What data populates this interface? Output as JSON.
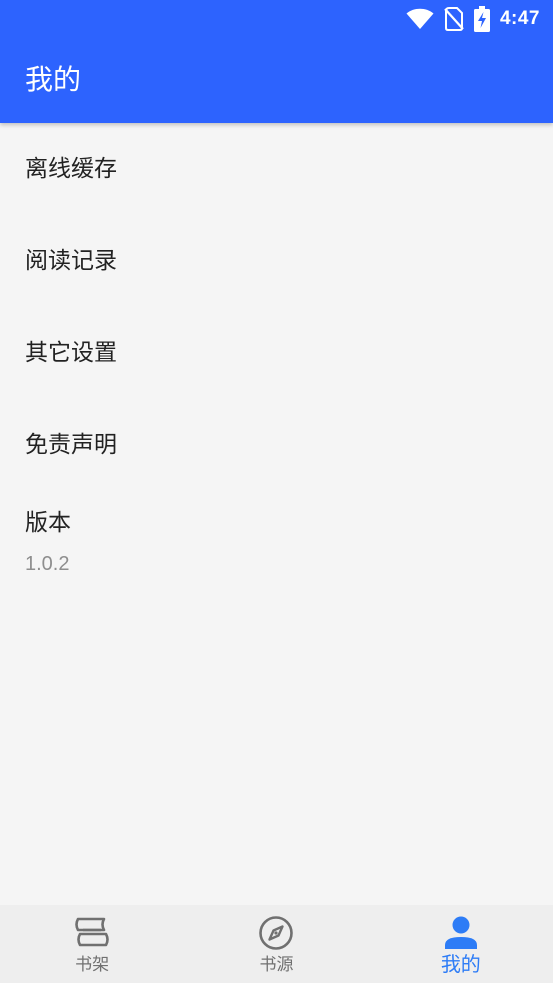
{
  "status_bar": {
    "time": "4:47",
    "icons": [
      "wifi-icon",
      "no-sim-icon",
      "battery-charging-icon"
    ]
  },
  "app_bar": {
    "title": "我的"
  },
  "menu": {
    "items": [
      {
        "label": "离线缓存"
      },
      {
        "label": "阅读记录"
      },
      {
        "label": "其它设置"
      },
      {
        "label": "免责声明"
      }
    ],
    "version": {
      "label": "版本",
      "value": "1.0.2"
    }
  },
  "bottom_nav": {
    "items": [
      {
        "label": "书架",
        "icon": "bookshelf-icon",
        "active": false
      },
      {
        "label": "书源",
        "icon": "compass-icon",
        "active": false
      },
      {
        "label": "我的",
        "icon": "person-icon",
        "active": true
      }
    ]
  },
  "colors": {
    "primary": "#2d63fe",
    "active_nav": "#2d7cf6",
    "background": "#f5f5f5",
    "nav_background": "#eeeeee",
    "inactive_nav": "#707070"
  }
}
